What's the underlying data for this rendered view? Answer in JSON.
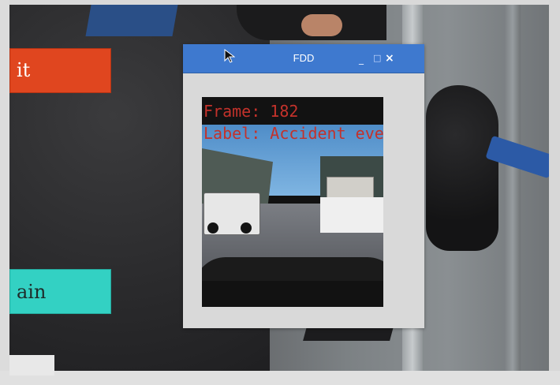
{
  "window": {
    "title": "FDD",
    "controls": {
      "minimize": "_",
      "maximize": "□",
      "close": "×"
    }
  },
  "video_overlay": {
    "frame_line": "Frame: 182",
    "label_line": "Label: Accident ever"
  },
  "left_panel": {
    "top_button_label": "it",
    "bottom_button_label": "ain"
  },
  "icons": {
    "pointer": "mouse-pointer-icon",
    "minimize": "minimize-icon",
    "maximize": "maximize-icon",
    "close": "close-icon"
  },
  "colors": {
    "titlebar": "#3e79cf",
    "overlay_text": "#c3322b",
    "button_red": "#e0461f",
    "button_teal": "#33d1c3"
  }
}
